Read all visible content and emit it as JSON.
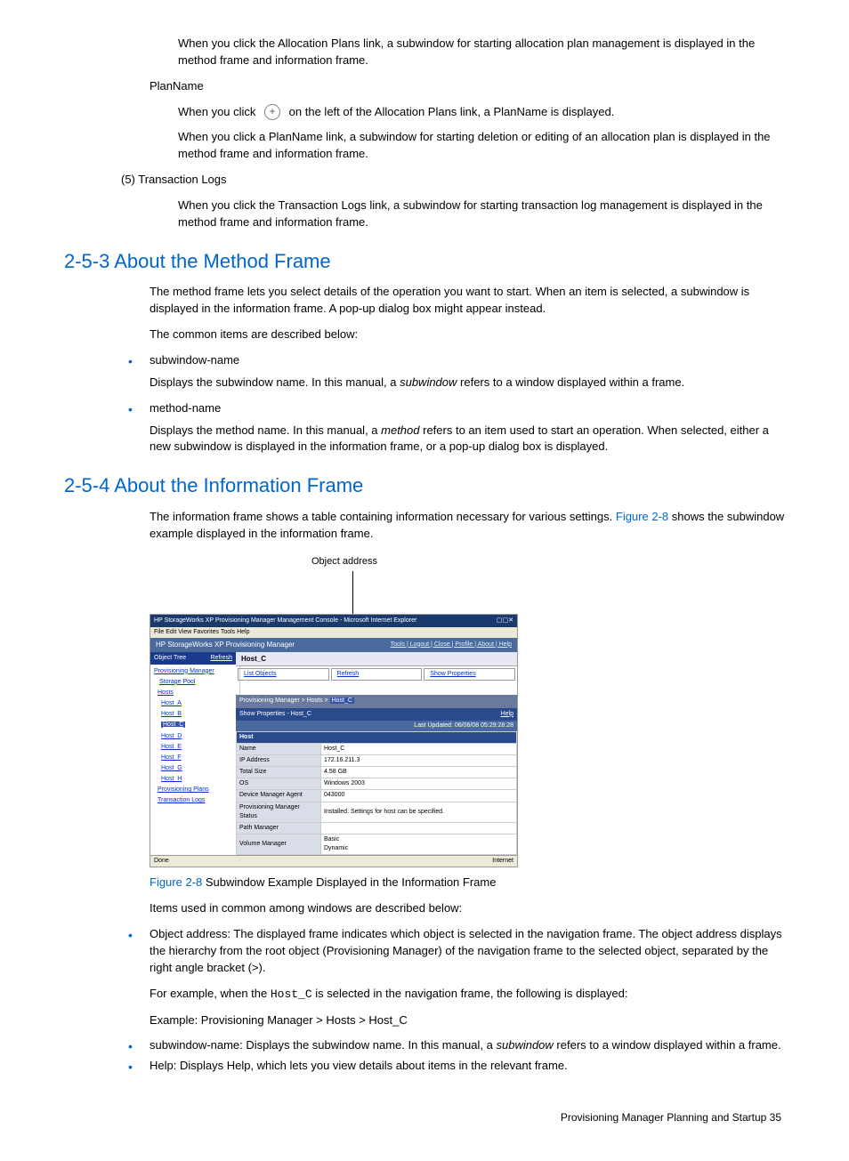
{
  "top": {
    "p1": "When you click the Allocation Plans link, a subwindow for starting allocation plan management is displayed in the method frame and information frame.",
    "planname_label": "PlanName",
    "p2_a": "When you click",
    "p2_b": "on the left of the Allocation Plans link, a PlanName is displayed.",
    "p3": "When you click a PlanName link, a subwindow for starting deletion or editing of an allocation plan is displayed in the method frame and information frame.",
    "tlogs_label": "(5) Transaction Logs",
    "p4": "When you click the Transaction Logs link, a subwindow for starting transaction log management is displayed in the method frame and information frame."
  },
  "s253": {
    "heading": "2-5-3 About the Method Frame",
    "p1": "The method frame lets you select details of the operation you want to start. When an item is selected, a subwindow is displayed in the information frame. A pop-up dialog box might appear instead.",
    "p2": "The common items are described below:",
    "b1_term": "subwindow-name",
    "b1_desc_a": "Displays the subwindow name. In this manual, a ",
    "b1_desc_i": "subwindow",
    "b1_desc_b": " refers to a window displayed within a frame.",
    "b2_term": "method-name",
    "b2_desc_a": "Displays the method name. In this manual, a ",
    "b2_desc_i": "method",
    "b2_desc_b": " refers to an item used to start an operation. When selected, either a new subwindow is displayed in the information frame, or a pop-up dialog box is displayed."
  },
  "s254": {
    "heading": "2-5-4 About the Information Frame",
    "p1_a": "The information frame shows a table containing information necessary for various settings. ",
    "p1_link": "Figure 2-8",
    "p1_b": " shows the subwindow example displayed in the information frame.",
    "obj_addr_label": "Object address",
    "figcap_num": "Figure 2-8",
    "figcap_txt": " Subwindow Example Displayed in the Information Frame",
    "p2": "Items used in common among windows are described below:",
    "li1": "Object address: The displayed frame indicates which object is selected in the navigation frame. The object address displays the hierarchy from the root object (Provisioning Manager) of the navigation frame to the selected object, separated by the right angle bracket (>).",
    "li1_ex_a": "For example, when the ",
    "li1_ex_code": "Host_C",
    "li1_ex_b": " is selected in the navigation frame, the following is displayed:",
    "li1_ex2": "Example: Provisioning Manager > Hosts > Host_C",
    "li2_a": "subwindow-name: Displays the subwindow name. In this manual, a ",
    "li2_i": "subwindow",
    "li2_b": " refers to a window displayed within a frame.",
    "li3": "Help: Displays Help, which lets you view details about items in the relevant frame."
  },
  "screenshot": {
    "titlebar": "HP StorageWorks XP Provisioning Manager Management Console - Microsoft Internet Explorer",
    "menubar": "File  Edit  View  Favorites  Tools  Help",
    "hdr_left": "HP StorageWorks XP Provisioning Manager",
    "hdr_links": "Tools | Logout | Close | Profile | About | Help",
    "tree_hdr": "Object Tree",
    "tree_refresh": "Refresh",
    "tree_root": "Provisioning Manager",
    "tree_sp": "Storage Pool",
    "tree_hosts": "Hosts",
    "tree_items": [
      "Host_A",
      "Host_B",
      "Host_C",
      "Host_D",
      "Host_E",
      "Host_F",
      "Host_G",
      "Host_H"
    ],
    "tree_ap": "Provisioning Plans",
    "tree_tl": "Transaction Logs",
    "tab": "Host_C",
    "act1": "List Objects",
    "act2": "Refresh",
    "act3": "Show Properties",
    "crumb": "Provisioning Manager > Hosts > ",
    "crumb_sel": "Host_C",
    "subhdr": "Show Properties - Host_C",
    "help": "Help",
    "updated": "Last Updated: 06/06/08 05:29:28:28",
    "rows": [
      [
        "Host",
        ""
      ],
      [
        "Name",
        "Host_C"
      ],
      [
        "IP Address",
        "172.16.211.3"
      ],
      [
        "Total Size",
        "4.58 GB"
      ],
      [
        "OS",
        "Windows 2003"
      ],
      [
        "Device Manager Agent",
        "043000"
      ],
      [
        "Provisioning Manager Status",
        "Installed. Settings for host can be specified."
      ],
      [
        "Path Manager",
        ""
      ],
      [
        "Volume Manager",
        "Basic\nDynamic"
      ]
    ],
    "status_l": "Done",
    "status_r": "Internet"
  },
  "footer": "Provisioning Manager Planning and Startup  35"
}
